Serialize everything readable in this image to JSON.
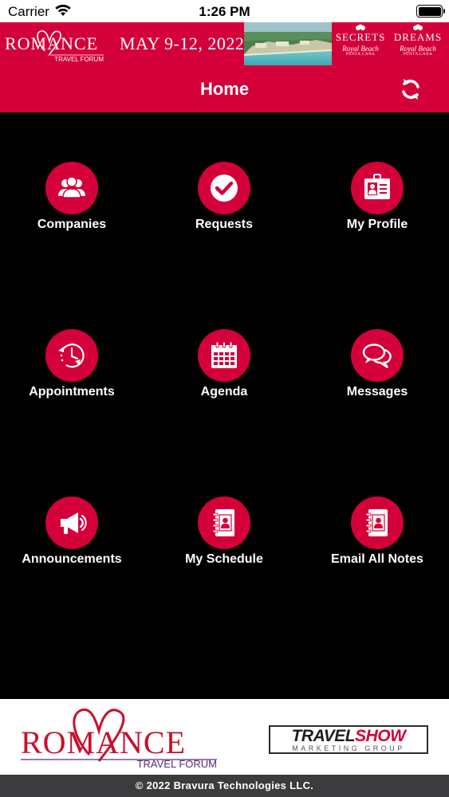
{
  "status_bar": {
    "carrier": "Carrier",
    "time": "1:26 PM"
  },
  "banner": {
    "logo_word": "ROMANCE",
    "logo_sub": "TRAVEL FORUM",
    "dates": "MAY 9-12, 2022",
    "secrets": {
      "name": "SECRETS",
      "sub": "Royal Beach",
      "loc": "PUNTA CANA"
    },
    "dreams": {
      "name": "DREAMS",
      "sub": "Royal Beach",
      "loc": "PUNTA CANA"
    }
  },
  "header": {
    "title": "Home",
    "refresh_icon": "refresh-icon"
  },
  "menu": {
    "companies": "Companies",
    "requests": "Requests",
    "my_profile": "My Profile",
    "appointments": "Appointments",
    "agenda": "Agenda",
    "messages": "Messages",
    "announcements": "Announcements",
    "my_schedule": "My Schedule",
    "email_all_notes": "Email All Notes"
  },
  "footer": {
    "logo_word": "ROMANCE",
    "logo_sub": "TRAVEL FORUM",
    "travelshow_part1": "TRAVEL",
    "travelshow_part2": "SHOW",
    "travelshow_sub": "MARKETING GROUP",
    "copyright": "© 2022 Bravura Technologies LLC."
  },
  "colors": {
    "accent": "#d4003a",
    "background": "#000000",
    "footer_bar": "#3c3c3e"
  }
}
